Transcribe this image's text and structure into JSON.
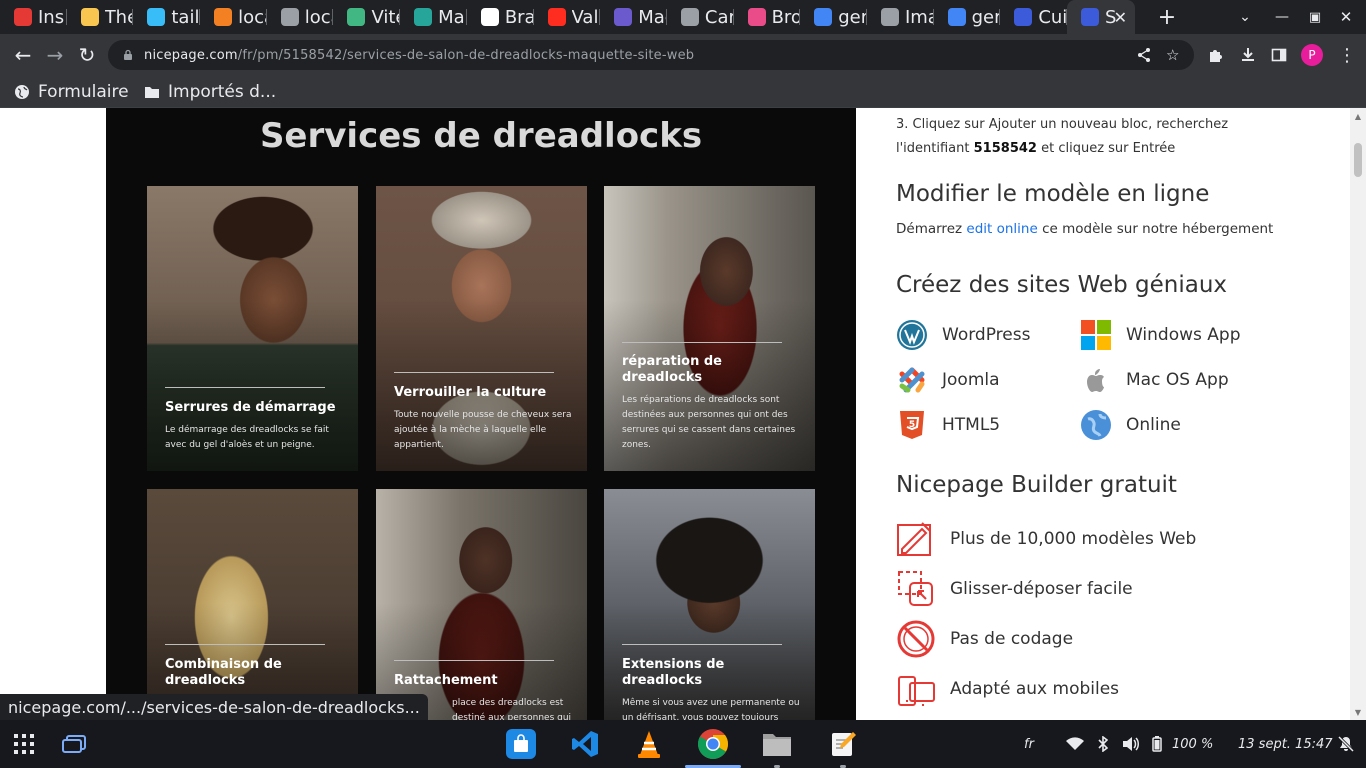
{
  "tabs": [
    {
      "title": "Ins",
      "icon": "red-stack-icon",
      "color": "#e53935"
    },
    {
      "title": "The",
      "icon": "yellow-notebook-icon",
      "color": "#f9c74f"
    },
    {
      "title": "tail",
      "icon": "tailwind-icon",
      "color": "#38bdf8"
    },
    {
      "title": "loca",
      "icon": "stack-stripes-icon",
      "color": "#f48024"
    },
    {
      "title": "loca",
      "icon": "globe-icon",
      "color": "#9aa0a6"
    },
    {
      "title": "Vite",
      "icon": "vue-icon",
      "color": "#41b883"
    },
    {
      "title": "Mai",
      "icon": "m-logo-icon",
      "color": "#26a69a"
    },
    {
      "title": "Bra",
      "icon": "github-icon",
      "color": "#ffffff"
    },
    {
      "title": "Vali",
      "icon": "laravel-icon",
      "color": "#ff2d20"
    },
    {
      "title": "Mac",
      "icon": "f-logo-icon",
      "color": "#6a5acd"
    },
    {
      "title": "Car",
      "icon": "globe-icon",
      "color": "#9aa0a6"
    },
    {
      "title": "Bro",
      "icon": "dribbble-icon",
      "color": "#ea4c89"
    },
    {
      "title": "ger",
      "icon": "google-icon",
      "color": "#4285f4"
    },
    {
      "title": "Ima",
      "icon": "globe-icon",
      "color": "#9aa0a6"
    },
    {
      "title": "ger",
      "icon": "google-icon",
      "color": "#4285f4"
    },
    {
      "title": "Cui",
      "icon": "nicepage-icon",
      "color": "#3b5bdb"
    },
    {
      "title": "S",
      "icon": "nicepage-icon",
      "color": "#3b5bdb",
      "active": true
    }
  ],
  "toolbar": {
    "url_host": "nicepage.com",
    "url_path": "/fr/pm/5158542/services-de-salon-de-dreadlocks-maquette-site-web"
  },
  "bookmarks": [
    {
      "label": "Formulaire",
      "icon": "globe-icon"
    },
    {
      "label": "Importés d...",
      "icon": "folder-icon"
    }
  ],
  "preview": {
    "title": "Services de dreadlocks",
    "cards": [
      {
        "title": "Serrures de démarrage",
        "text": "Le démarrage des dreadlocks se fait avec du gel d'aloès et un peigne."
      },
      {
        "title": "Verrouiller la culture",
        "text": "Toute nouvelle pousse de cheveux sera ajoutée à la mèche à laquelle elle appartient."
      },
      {
        "title": "réparation de dreadlocks",
        "text": "Les réparations de dreadlocks sont destinées aux personnes qui ont des serrures qui se cassent dans certaines zones."
      },
      {
        "title": "Combinaison de dreadlocks",
        "text": ""
      },
      {
        "title": "Rattachement",
        "text": "place des dreadlocks est destiné aux personnes qui ont coupé"
      },
      {
        "title": "Extensions de dreadlocks",
        "text": "Même si vous avez une permanente ou un défrisant, vous pouvez toujours"
      }
    ]
  },
  "info": {
    "step_text": "3. Cliquez sur Ajouter un nouveau bloc, recherchez l'identifiant",
    "step_id": "5158542",
    "step_end": "et cliquez sur Entrée",
    "edit_heading": "Modifier le modèle en ligne",
    "edit_pre": "Démarrez",
    "edit_link": "edit online",
    "edit_post": "ce modèle sur notre hébergement",
    "create_heading": "Créez des sites Web géniaux",
    "platforms": [
      "WordPress",
      "Windows App",
      "Joomla",
      "Mac OS App",
      "HTML5",
      "Online"
    ],
    "builder_heading": "Nicepage Builder gratuit",
    "features": [
      "Plus de 10,000 modèles Web",
      "Glisser-déposer facile",
      "Pas de codage",
      "Adapté aux mobiles"
    ]
  },
  "status_url": "nicepage.com/.../services-de-salon-de-dreadlocks...",
  "taskbar": {
    "language": "fr",
    "battery": "100 %",
    "datetime": "13 sept. 15:47"
  },
  "colors": {
    "accent_red": "#e53935",
    "link_blue": "#1a73e8",
    "profile_pink": "#e81d9c"
  }
}
